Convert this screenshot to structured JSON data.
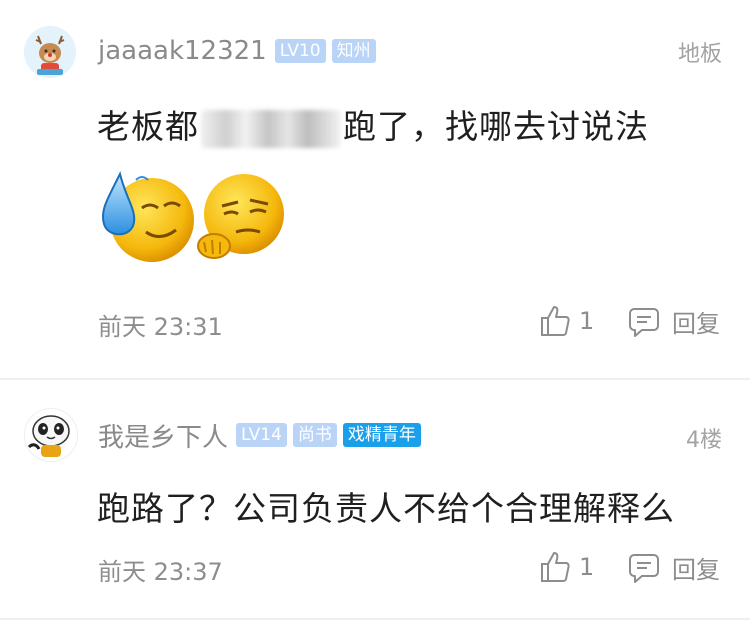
{
  "comments": [
    {
      "username": "jaaaak12321",
      "badges": [
        "LV10",
        "知州"
      ],
      "floor": "地板",
      "content_before": "老板都",
      "content_after": "跑了，找哪去讨说法",
      "time": "前天 23:31",
      "likes": "1",
      "reply_label": "回复",
      "emoji_names": [
        "sweat-smile-emoji",
        "smirk-wave-emoji"
      ]
    },
    {
      "username": "我是乡下人",
      "badges": [
        "LV14",
        "尚书",
        "戏精青年"
      ],
      "floor": "4楼",
      "content": "跑路了？公司负责人不给个合理解释么",
      "time": "前天 23:37",
      "likes": "1",
      "reply_label": "回复"
    }
  ],
  "colors": {
    "badge_light": "#b9d4f7",
    "badge_strong": "#1aa0ea",
    "text_muted": "#8d8d8d",
    "divider": "#efefef"
  }
}
